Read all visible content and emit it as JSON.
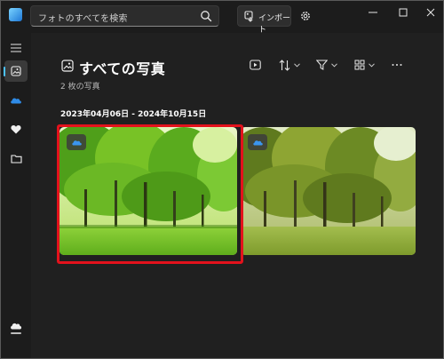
{
  "titlebar": {
    "search": {
      "placeholder": "フォトのすべてを検索"
    },
    "import_label": "インポート"
  },
  "main": {
    "title": "すべての写真",
    "photo_count": "2 枚の写真",
    "date_range": "2023年04月06日 - 2024年10月15日"
  },
  "photos": [
    {
      "name": "forest-photo-1",
      "cloud_icon": "onedrive-icon",
      "selected": true
    },
    {
      "name": "forest-photo-2",
      "cloud_icon": "onedrive-icon",
      "selected": false
    }
  ],
  "colors": {
    "accent": "#4cc2ff",
    "selection_outline": "#e3121c",
    "background": "#202020"
  }
}
